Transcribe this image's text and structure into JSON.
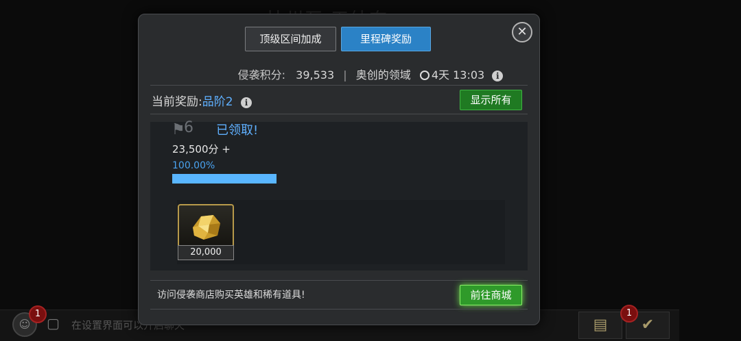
{
  "background": {
    "title": "扶州互 天纳奔",
    "chat_text": "在设置界面可以开启聊天",
    "team_badge": "1",
    "right_badge": "1"
  },
  "tabs": [
    {
      "label": "顶级区间加成",
      "active": false
    },
    {
      "label": "里程碑奖励",
      "active": true
    }
  ],
  "score": {
    "label": "侵袭积分:",
    "value": "39,533",
    "separator": "|",
    "realm": "奥创的领域",
    "timer": "4天 13:03"
  },
  "current_reward": {
    "label": "当前奖励:",
    "tier": "品阶2",
    "show_all_label": "显示所有"
  },
  "milestone": {
    "number": "6",
    "status": "已领取!",
    "points": "23,500分 +",
    "percent_text": "100.00%",
    "progress": 1.0,
    "item": {
      "icon": "gold-icon",
      "quantity": "20,000"
    }
  },
  "shop": {
    "text": "访问侵袭商店购买英雄和稀有道具!",
    "button_label": "前往商城"
  },
  "colors": {
    "accent_blue": "#2b82c6",
    "claimed_blue": "#5fb0ff",
    "green_button": "#1f7a22",
    "gold": "#d4a93a"
  }
}
